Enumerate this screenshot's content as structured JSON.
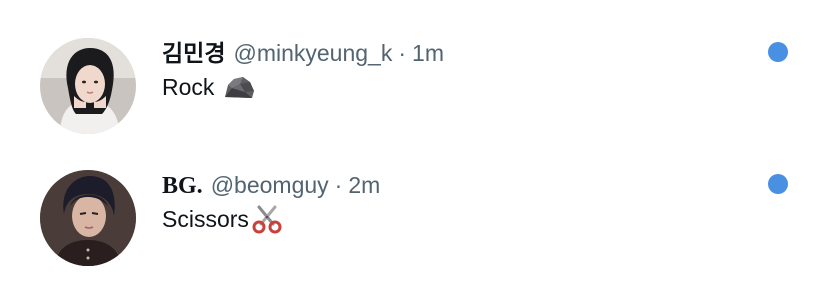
{
  "theme": {
    "text_color": "#0f1419",
    "secondary_text_color": "#536471",
    "unread_dot_color": "#4a90e2"
  },
  "tweets": [
    {
      "display_name": "김민경",
      "handle": "@minkyeung_k",
      "separator": "·",
      "time": "1m",
      "text": "Rock",
      "icon": "rock-icon",
      "avatar_icon": "avatar-person-hands-on-cheeks",
      "unread": true
    },
    {
      "display_name": "BG.",
      "handle": "@beomguy",
      "separator": "·",
      "time": "2m",
      "text": "Scissors",
      "icon": "scissors-icon",
      "avatar_icon": "avatar-person-dark-hair",
      "unread": true
    }
  ]
}
